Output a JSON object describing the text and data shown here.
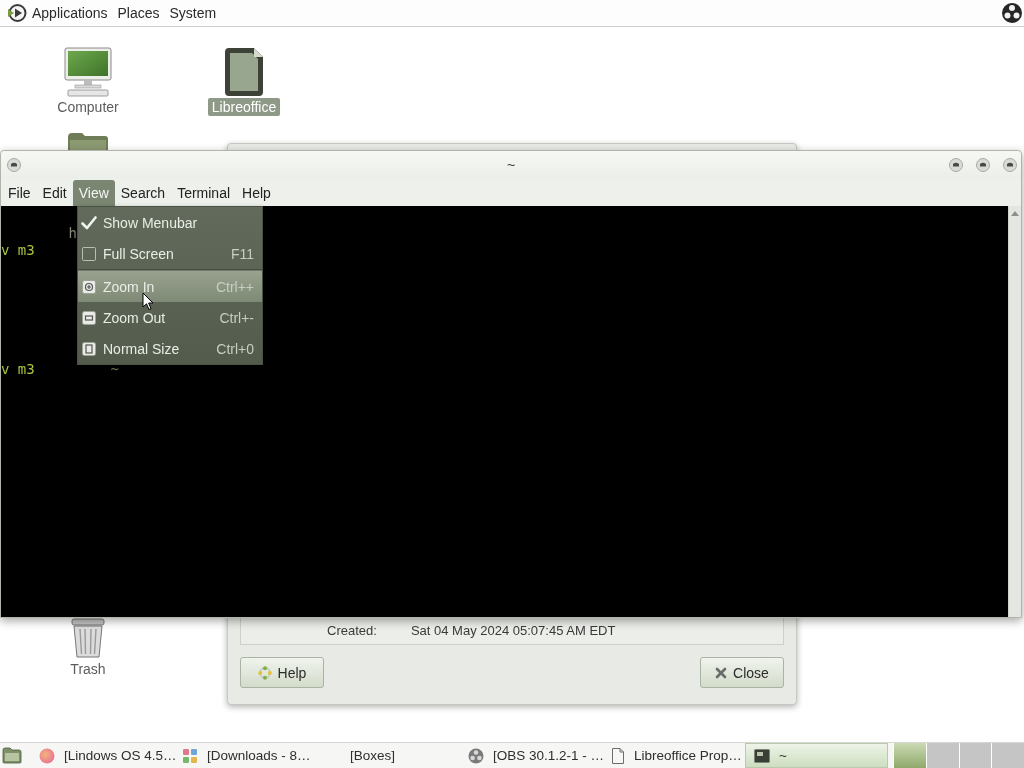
{
  "top_panel": {
    "menus": [
      {
        "label": "Applications"
      },
      {
        "label": "Places"
      },
      {
        "label": "System"
      }
    ]
  },
  "desktop_icons": [
    {
      "kind": "computer",
      "label": "Computer",
      "selected": false
    },
    {
      "kind": "document",
      "label": "Libreoffice",
      "selected": true
    },
    {
      "kind": "folder",
      "selected": false
    },
    {
      "kind": "trash",
      "label": "Trash",
      "selected": false
    }
  ],
  "properties_dialog": {
    "fields": [
      {
        "label": "Created:",
        "value": "Sat 04 May 2024 05:07:45 AM EDT"
      }
    ],
    "buttons": [
      {
        "kind": "help",
        "label": "Help"
      },
      {
        "kind": "close",
        "label": "Close"
      }
    ]
  },
  "terminal": {
    "title": "~",
    "menus": [
      {
        "label": "File",
        "selected": false
      },
      {
        "label": "Edit",
        "selected": false
      },
      {
        "label": "View",
        "selected": true
      },
      {
        "label": "Search",
        "selected": false
      },
      {
        "label": "Terminal",
        "selected": false
      },
      {
        "label": "Help",
        "selected": false
      }
    ],
    "lines": [
      {
        "segments": [
          {
            "kind": "output",
            "text": "h"
          }
        ]
      },
      {
        "segments": [
          {
            "kind": "prompt",
            "text": "v m3"
          }
        ]
      },
      {
        "segments": [
          {
            "kind": "prompt",
            "text": "v m3"
          },
          {
            "kind": "path",
            "text": "~"
          }
        ]
      }
    ],
    "view_menu": {
      "sections": [
        {
          "items": [
            {
              "kind": "check",
              "label": "Show Menubar",
              "checked": true,
              "selected": false
            },
            {
              "kind": "check",
              "label": "Full Screen",
              "shortcut": "F11",
              "checked": false,
              "selected": false
            }
          ]
        },
        {
          "items": [
            {
              "kind": "zoomin",
              "label": "Zoom In",
              "shortcut": "Ctrl++",
              "selected": true
            },
            {
              "kind": "zoomout",
              "label": "Zoom Out",
              "shortcut": "Ctrl+-",
              "selected": false
            },
            {
              "kind": "reset",
              "label": "Normal Size",
              "shortcut": "Ctrl+0",
              "selected": false
            }
          ]
        }
      ]
    }
  },
  "taskbar": {
    "tasks": [
      {
        "kind": "browser",
        "label": "[Lindows OS 4.5…",
        "selected": false
      },
      {
        "kind": "files",
        "label": "[Downloads - 8…",
        "selected": false
      },
      {
        "kind": "none",
        "label": "[Boxes]",
        "selected": false
      },
      {
        "kind": "recorder",
        "label": "[OBS 30.1.2-1 - …",
        "selected": false
      },
      {
        "kind": "document",
        "label": "Libreoffice Prop…",
        "selected": false
      },
      {
        "kind": "terminal",
        "label": "~",
        "selected": true
      }
    ],
    "workspaces": [
      {
        "selected": true
      },
      {
        "selected": false
      },
      {
        "selected": false
      },
      {
        "selected": false
      }
    ]
  }
}
